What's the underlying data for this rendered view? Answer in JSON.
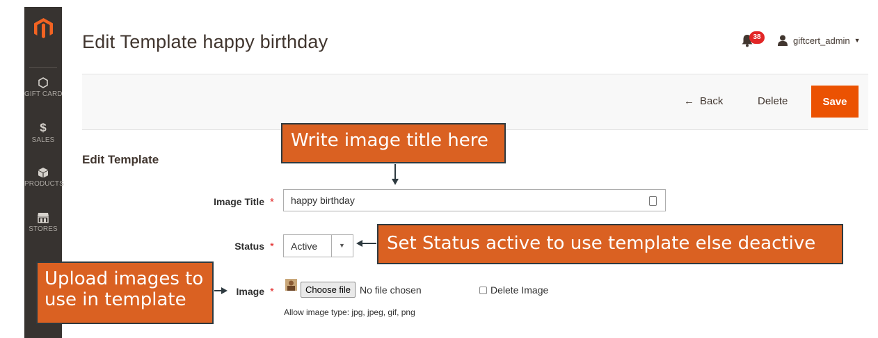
{
  "sidebar": {
    "logo": "magento-logo-icon",
    "items": [
      {
        "label": "GIFT CARD",
        "icon": "hexagon-icon"
      },
      {
        "label": "SALES",
        "icon": "dollar-icon"
      },
      {
        "label": "PRODUCTS",
        "icon": "box-icon"
      },
      {
        "label": "STORES",
        "icon": "store-icon"
      }
    ]
  },
  "header": {
    "title": "Edit Template happy birthday",
    "notifications_count": "38",
    "username": "giftcert_admin"
  },
  "actions": {
    "back_label": "Back",
    "delete_label": "Delete",
    "save_label": "Save"
  },
  "form": {
    "section_title": "Edit Template",
    "image_title_label": "Image Title",
    "image_title_value": "happy birthday",
    "status_label": "Status",
    "status_value": "Active",
    "image_label": "Image",
    "choose_file_label": "Choose file",
    "no_file_text": "No file chosen",
    "delete_image_label": "Delete Image",
    "allowed_types_hint": "Allow image type: jpg, jpeg, gif, png",
    "required_marker": "*"
  },
  "callouts": {
    "title": "Write image title here",
    "status": "Set Status active to use template else deactive",
    "upload": "Upload images to use in template"
  },
  "colors": {
    "accent": "#eb5202",
    "sidebar": "#373330",
    "callout": "#da6122",
    "badge": "#e22626"
  }
}
